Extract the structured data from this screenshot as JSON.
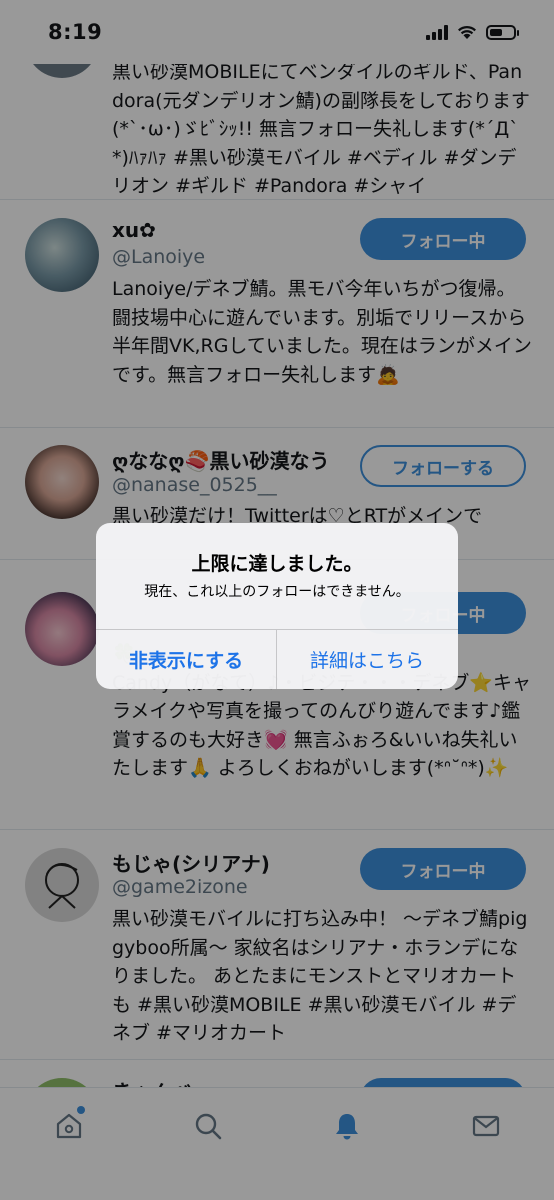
{
  "status_bar": {
    "time": "8:19"
  },
  "users": [
    {
      "name": "",
      "handle": "",
      "button": "",
      "bio": "黒い砂漠MOBILEにてベンダイルのギルド、Pandora(元ダンデリオン鯖)の副隊長をしております(*`･ω･)ゞﾋﾞｼｯ!! 無言フォロー失礼します(*´Д`*)ﾊｧﾊｧ #黒い砂漠モバイル #ベディル #ダンデリオン #ギルド #Pandora #シャイ"
    },
    {
      "name": "xu✿",
      "handle": "@Lanoiye",
      "button": "フォロー中",
      "bio": "Lanoiye/デネブ鯖。黒モバ今年いちがつ復帰。闘技場中心に遊んでいます。別垢でリリースから半年間VK,RGしていました。現在はランがメインです。無言フォロー失礼します🙇"
    },
    {
      "name": "ღななღ🍣黒い砂漠なう",
      "handle": "@nanase_0525__",
      "button": "フォローする",
      "bio": "黒い砂漠だけ！Twitterは♡とRTがメインで"
    },
    {
      "name": "",
      "handle": "",
      "button": "フォロー中",
      "bio": "🍀\nCandy（がなて）♪・ビジテ・・・デネブ⭐キャラメイクや写真を撮ってのんびり遊んでます♪鑑賞するのも大好き💓 無言ふぉろ&いいね失礼いたします🙏 よろしくおねがいします(*ᐢ˘ᐢ*)✨"
    },
    {
      "name": "もじゃ(シリアナ)",
      "handle": "@game2izone",
      "button": "フォロー中",
      "bio": "黒い砂漠モバイルに打ち込み中！ 〜デネブ鯖piggyboo所属〜 家紋名はシリアナ・ホランデになりました。 あとたまにモンストとマリオカートも #黒い砂漠MOBILE #黒い砂漠モバイル #デネブ #マリオカート"
    },
    {
      "name": "きゃんべ",
      "handle": "",
      "button": "",
      "bio": ""
    }
  ],
  "tab_bar": {
    "tabs": [
      {
        "icon": "home-icon",
        "active": false,
        "badge": true
      },
      {
        "icon": "search-icon",
        "active": false,
        "badge": false
      },
      {
        "icon": "bell-icon",
        "active": true,
        "badge": false
      },
      {
        "icon": "mail-icon",
        "active": false,
        "badge": false
      }
    ]
  },
  "alert": {
    "title": "上限に達しました。",
    "message": "現在、これ以上のフォローはできません。",
    "cancel_label": "非表示にする",
    "details_label": "詳細はこちら"
  },
  "colors": {
    "accent": "#3d8fdc",
    "alert_button": "#1d73e8",
    "handle": "#657786"
  }
}
